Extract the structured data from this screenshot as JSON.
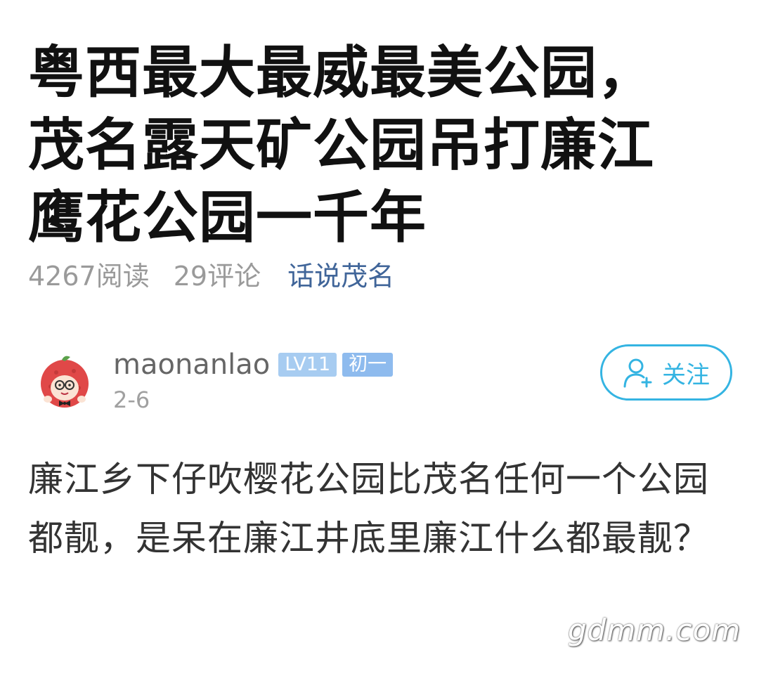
{
  "post": {
    "title": "粤西最大最威最美公园，茂名露天矿公园吊打廉江鹰花公园一千年",
    "reads": "4267阅读",
    "comments": "29评论",
    "topic": "话说茂名",
    "content": "廉江乡下仔吹樱花公园比茂名任何一个公园都靓，是呆在廉江井底里廉江什么都最靓？"
  },
  "author": {
    "name": "maonanlao",
    "level_badge": "LV11",
    "rank_badge": "初一",
    "date": "2-6",
    "avatar_icon": "lychee-mascot-avatar"
  },
  "follow": {
    "label": "关注",
    "icon": "add-user-icon",
    "color": "#34b4e2"
  },
  "watermark": "gdmm.com"
}
